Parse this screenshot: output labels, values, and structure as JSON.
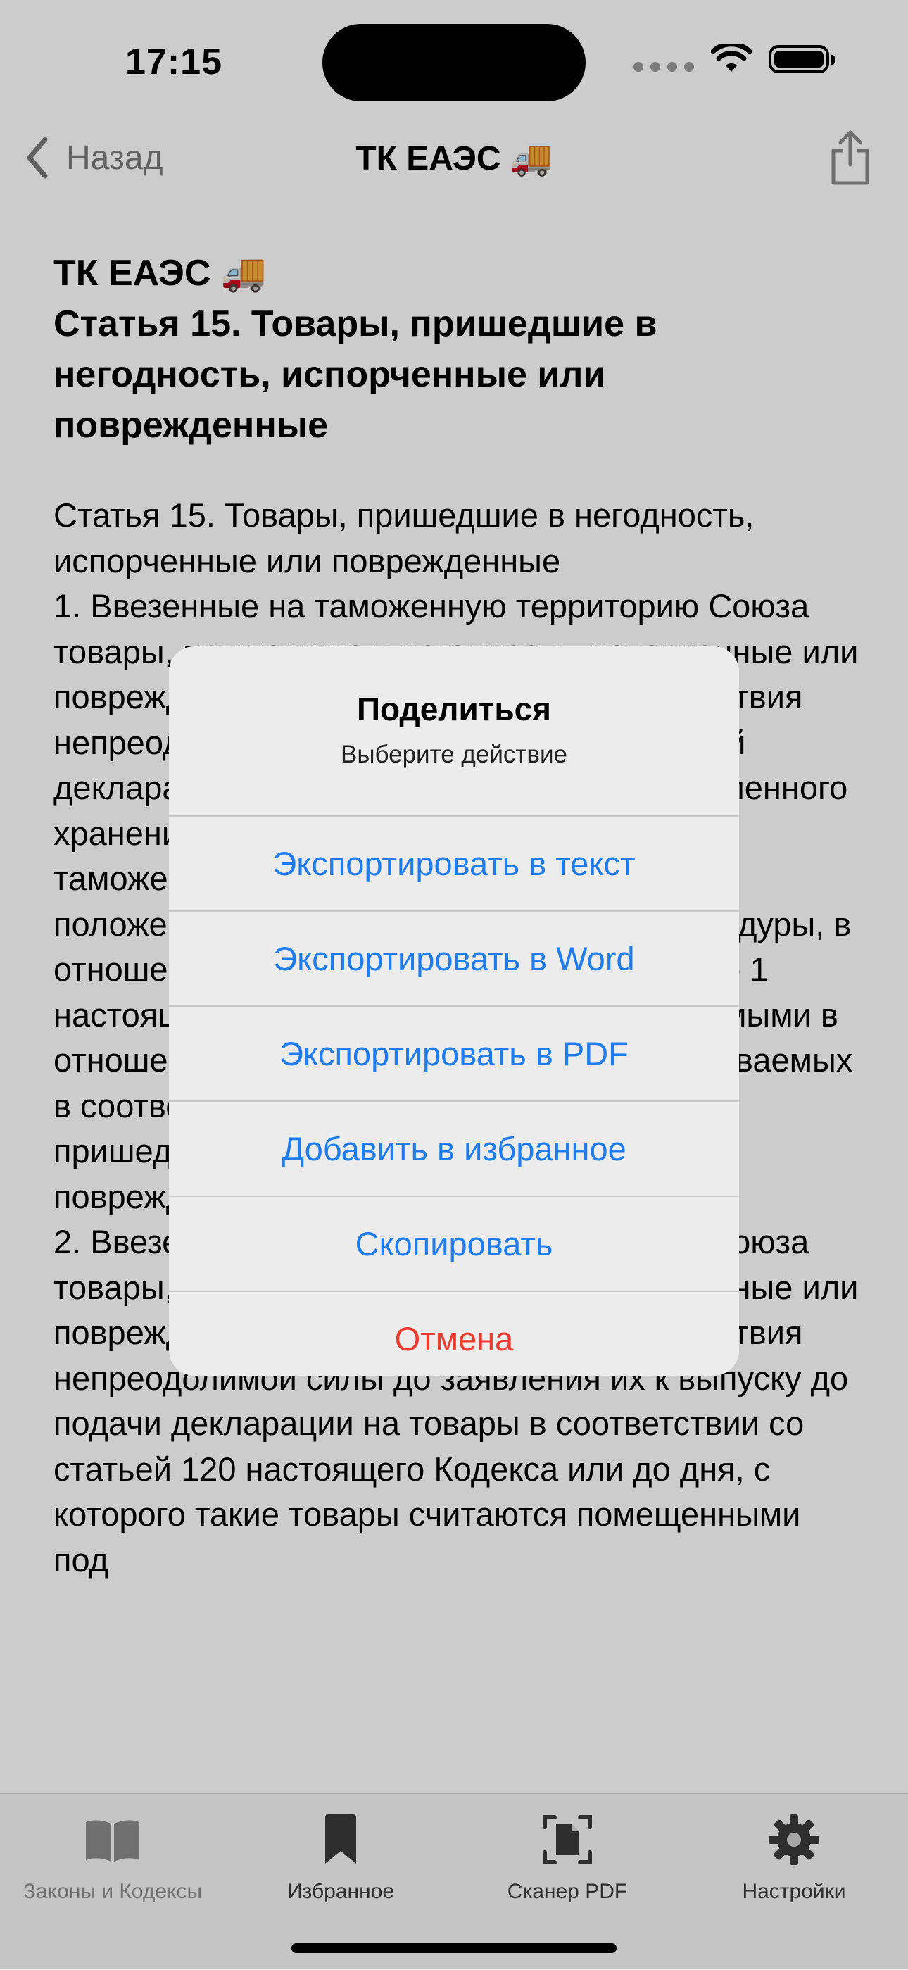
{
  "status_bar": {
    "time": "17:15"
  },
  "nav": {
    "back_label": "Назад",
    "title": "ТК ЕАЭС 🚚"
  },
  "article": {
    "title": "ТК ЕАЭС 🚚\nСтатья 15. Товары, пришедшие в негодность, испорченные или поврежденные",
    "body": "Статья 15. Товары, пришедшие в негодность, испорченные или поврежденные\n1. Ввезенные на таможенную территорию Союза товары, пришедшие в негодность, испорченные или поврежденные вследствие аварии или действия непреодолимой силы до подачи таможенной декларации на товары или в период их временного хранения, считаются переведенными по таможенной процедуре в соответствии с положениями настоящей таможенной процедуры, в отношении которых в соответствии с частью 1 настоящей статьи считаются рассматриваемыми в отношении которых с прибытием рассматриваемых в соответствии с таможенной процедурой в пришедшем в негодность, испорченном или поврежденном состоянии.\n2. Ввезенные на таможенную территорию Союза товары, пришедшие в негодность, испорченные или поврежденные вследствие аварии или действия непреодолимой силы до заявления их к выпуску до подачи декларации на товары в соответствии со статьей 120 настоящего Кодекса или до дня, с которого такие товары считаются помещенными под"
  },
  "share_dialog": {
    "title": "Поделиться",
    "subtitle": "Выберите действие",
    "actions": {
      "export_text": "Экспортировать в текст",
      "export_word": "Экспортировать в Word",
      "export_pdf": "Экспортировать в PDF",
      "add_favorite": "Добавить в избранное",
      "copy": "Скопировать",
      "cancel": "Отмена"
    },
    "colors": {
      "action": "#1e7cf0",
      "cancel": "#ee3b30"
    }
  },
  "tab_bar": {
    "laws": "Законы и Кодексы",
    "favorites": "Избранное",
    "scanner": "Сканер PDF",
    "settings": "Настройки"
  }
}
